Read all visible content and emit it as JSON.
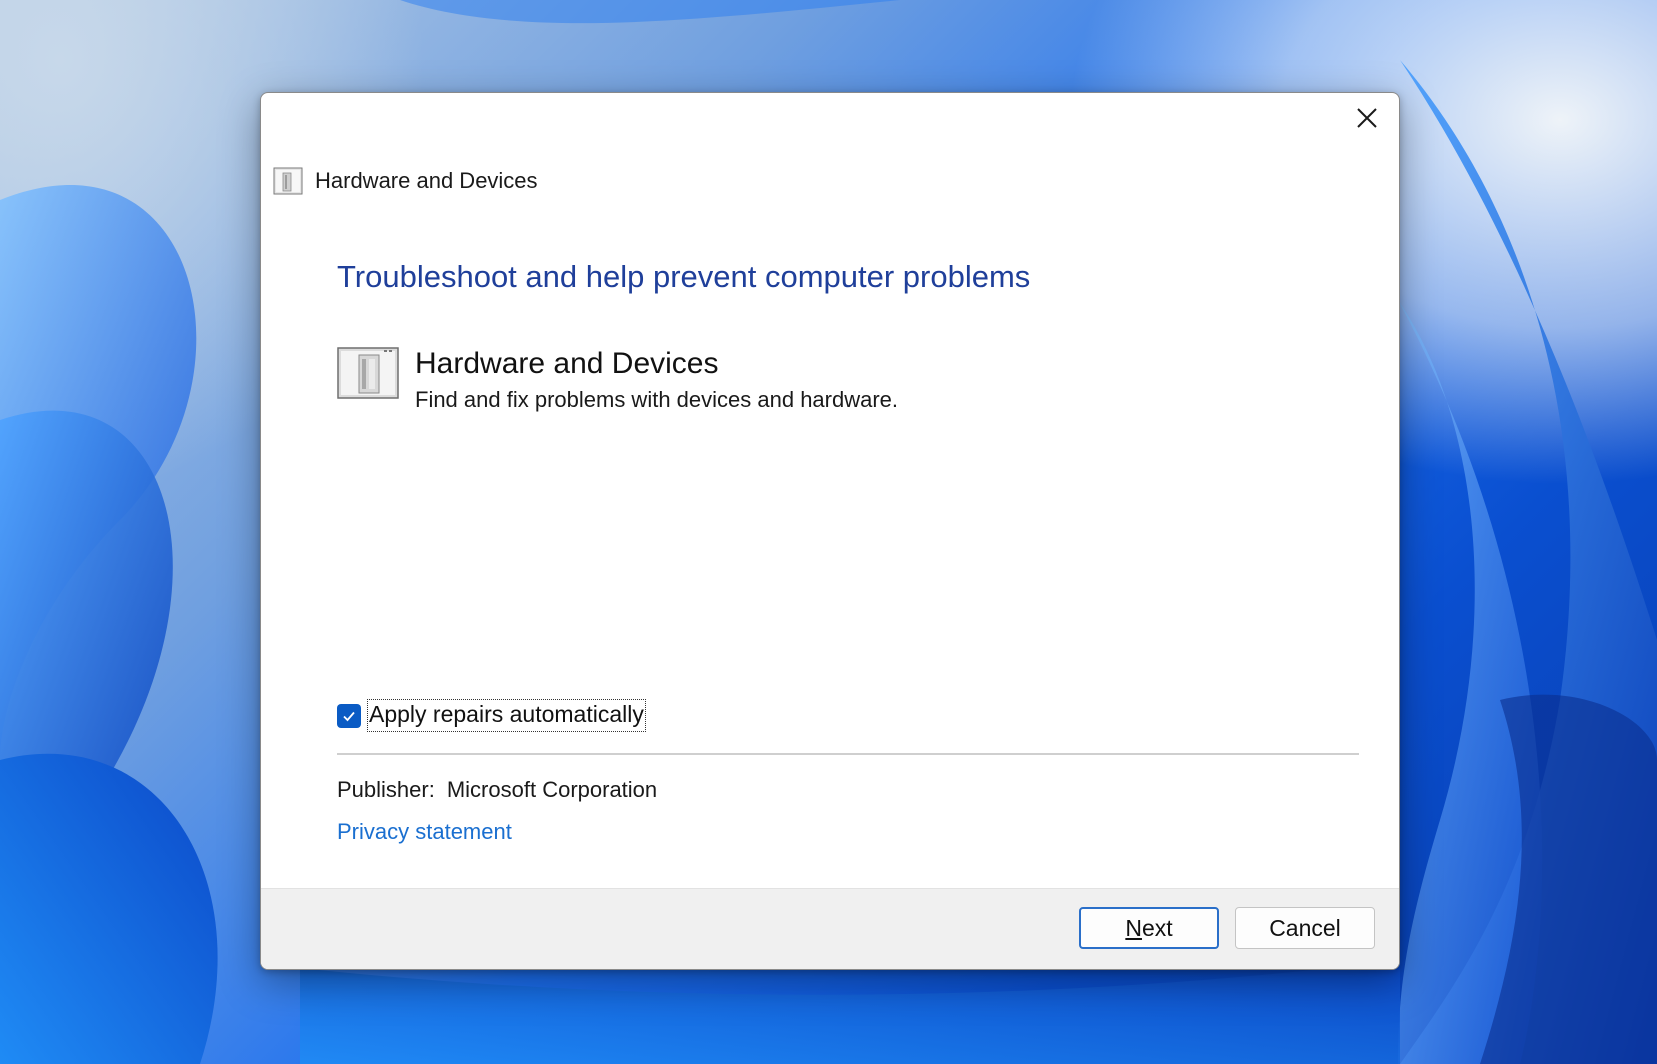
{
  "window": {
    "title": "Hardware and Devices",
    "close_icon": "close-icon",
    "title_icon": "hardware-devices-icon"
  },
  "main": {
    "heading": "Troubleshoot and help prevent computer problems",
    "troubleshooter": {
      "name": "Hardware and Devices",
      "description": "Find and fix problems with devices and hardware.",
      "icon": "hardware-devices-icon"
    },
    "apply_repairs": {
      "label": "Apply repairs automatically",
      "checked": true
    },
    "publisher": {
      "label": "Publisher:",
      "value": "Microsoft Corporation"
    },
    "privacy_link": "Privacy statement"
  },
  "footer": {
    "next_mnemonic": "N",
    "next_rest": "ext",
    "cancel_label": "Cancel"
  },
  "colors": {
    "heading": "#1f3f9a",
    "link": "#1a6fd0",
    "checkbox": "#0a5bc4",
    "accent_border": "#2a6fc9"
  }
}
